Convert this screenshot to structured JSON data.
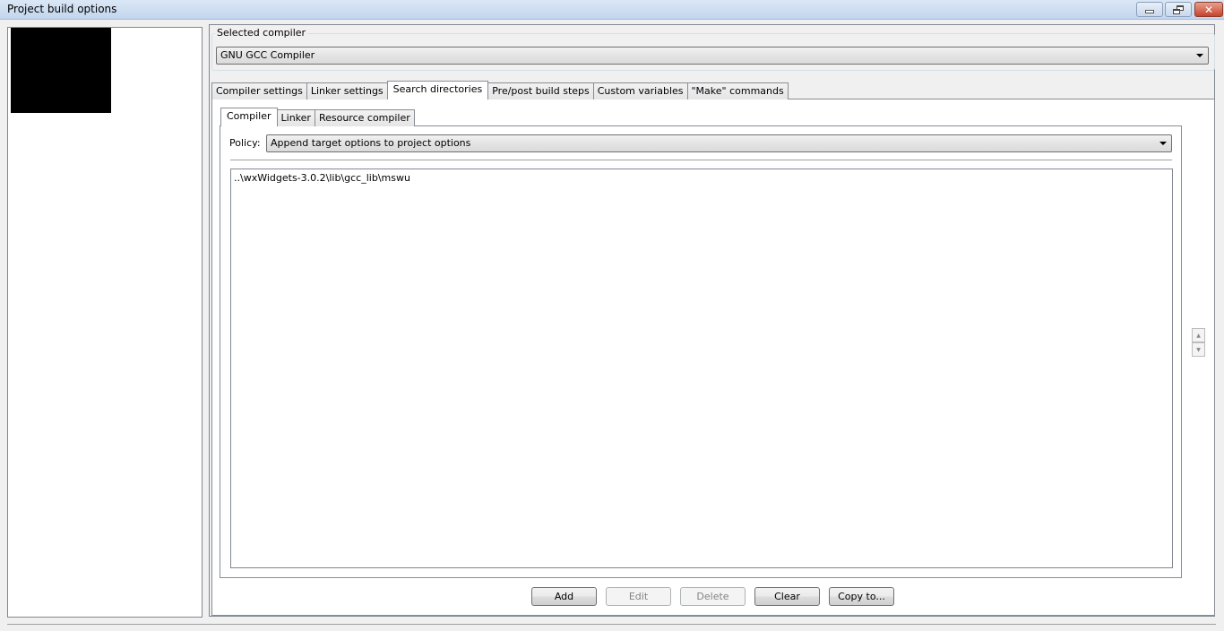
{
  "window": {
    "title": "Project build options",
    "controls": {
      "minimize": "minimize",
      "restore": "restore",
      "close": "close"
    }
  },
  "compiler_group": {
    "label": "Selected compiler",
    "selected": "GNU GCC Compiler"
  },
  "outer_tabs": [
    {
      "label": "Compiler settings",
      "active": false
    },
    {
      "label": "Linker settings",
      "active": false
    },
    {
      "label": "Search directories",
      "active": true
    },
    {
      "label": "Pre/post build steps",
      "active": false
    },
    {
      "label": "Custom variables",
      "active": false
    },
    {
      "label": "\"Make\" commands",
      "active": false
    }
  ],
  "inner_tabs": [
    {
      "label": "Compiler",
      "active": true
    },
    {
      "label": "Linker",
      "active": false
    },
    {
      "label": "Resource compiler",
      "active": false
    }
  ],
  "policy": {
    "label": "Policy:",
    "selected": "Append target options to project options"
  },
  "directories": [
    "..\\wxWidgets-3.0.2\\lib\\gcc_lib\\mswu"
  ],
  "buttons": {
    "add": {
      "label": "Add",
      "enabled": true
    },
    "edit": {
      "label": "Edit",
      "enabled": false
    },
    "delete": {
      "label": "Delete",
      "enabled": false
    },
    "clear": {
      "label": "Clear",
      "enabled": true
    },
    "copy_to": {
      "label": "Copy to...",
      "enabled": true
    }
  },
  "spin": {
    "up": "▲",
    "down": "▼"
  }
}
